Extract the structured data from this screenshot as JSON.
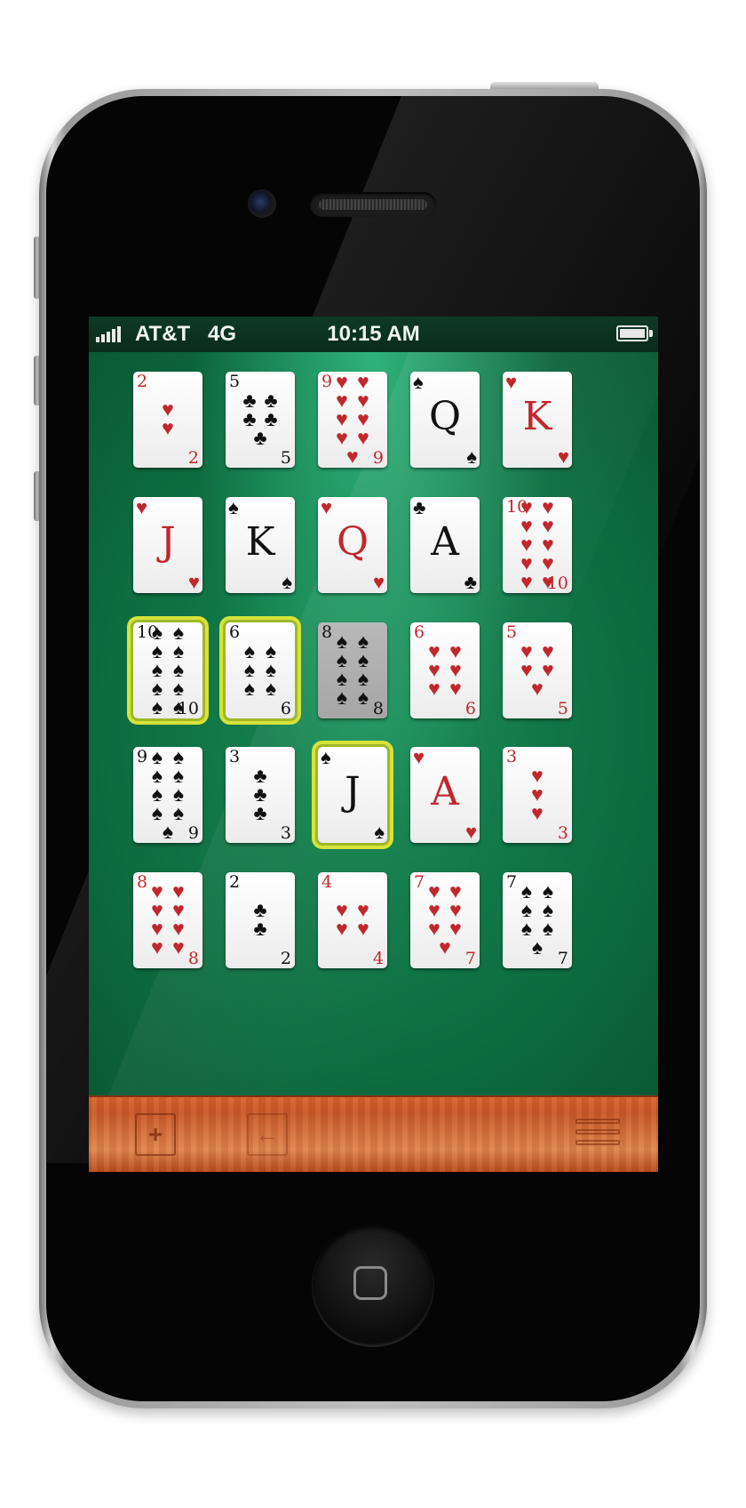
{
  "status_bar": {
    "carrier": "AT&T",
    "network": "4G",
    "time": "10:15 AM"
  },
  "cards": [
    {
      "rank": "2",
      "suit": "♥",
      "color": "red",
      "pips": 2
    },
    {
      "rank": "5",
      "suit": "♣",
      "color": "black",
      "pips": 5
    },
    {
      "rank": "9",
      "suit": "♥",
      "color": "red",
      "pips": 9
    },
    {
      "rank": "Q",
      "suit": "♠",
      "color": "black",
      "pips": 0
    },
    {
      "rank": "K",
      "suit": "♥",
      "color": "red",
      "pips": 0
    },
    {
      "rank": "J",
      "suit": "♥",
      "color": "red",
      "pips": 0
    },
    {
      "rank": "K",
      "suit": "♠",
      "color": "black",
      "pips": 0
    },
    {
      "rank": "Q",
      "suit": "♥",
      "color": "red",
      "pips": 0
    },
    {
      "rank": "A",
      "suit": "♣",
      "color": "black",
      "pips": 0
    },
    {
      "rank": "10",
      "suit": "♥",
      "color": "red",
      "pips": 10
    },
    {
      "rank": "10",
      "suit": "♠",
      "color": "black",
      "pips": 10,
      "selected": true
    },
    {
      "rank": "6",
      "suit": "♠",
      "color": "black",
      "pips": 6,
      "selected": true
    },
    {
      "rank": "8",
      "suit": "♠",
      "color": "black",
      "pips": 8,
      "dimmed": true
    },
    {
      "rank": "6",
      "suit": "♥",
      "color": "red",
      "pips": 6
    },
    {
      "rank": "5",
      "suit": "♥",
      "color": "red",
      "pips": 5
    },
    {
      "rank": "9",
      "suit": "♠",
      "color": "black",
      "pips": 9
    },
    {
      "rank": "3",
      "suit": "♣",
      "color": "black",
      "pips": 3
    },
    {
      "rank": "J",
      "suit": "♠",
      "color": "black",
      "pips": 0,
      "selected": true
    },
    {
      "rank": "A",
      "suit": "♥",
      "color": "red",
      "pips": 0
    },
    {
      "rank": "3",
      "suit": "♥",
      "color": "red",
      "pips": 3
    },
    {
      "rank": "8",
      "suit": "♥",
      "color": "red",
      "pips": 8
    },
    {
      "rank": "2",
      "suit": "♣",
      "color": "black",
      "pips": 2
    },
    {
      "rank": "4",
      "suit": "♥",
      "color": "red",
      "pips": 4
    },
    {
      "rank": "7",
      "suit": "♥",
      "color": "red",
      "pips": 7
    },
    {
      "rank": "7",
      "suit": "♠",
      "color": "black",
      "pips": 7
    }
  ],
  "toolbar": {
    "add_icon": "plus-icon",
    "undo_icon": "arrow-left-icon",
    "menu_icon": "menu-icon"
  },
  "colors": {
    "felt": "#178a55",
    "red_suit": "#c1272d",
    "black_suit": "#111111",
    "selection": "#d6e33a",
    "wood": "#d9652f"
  }
}
